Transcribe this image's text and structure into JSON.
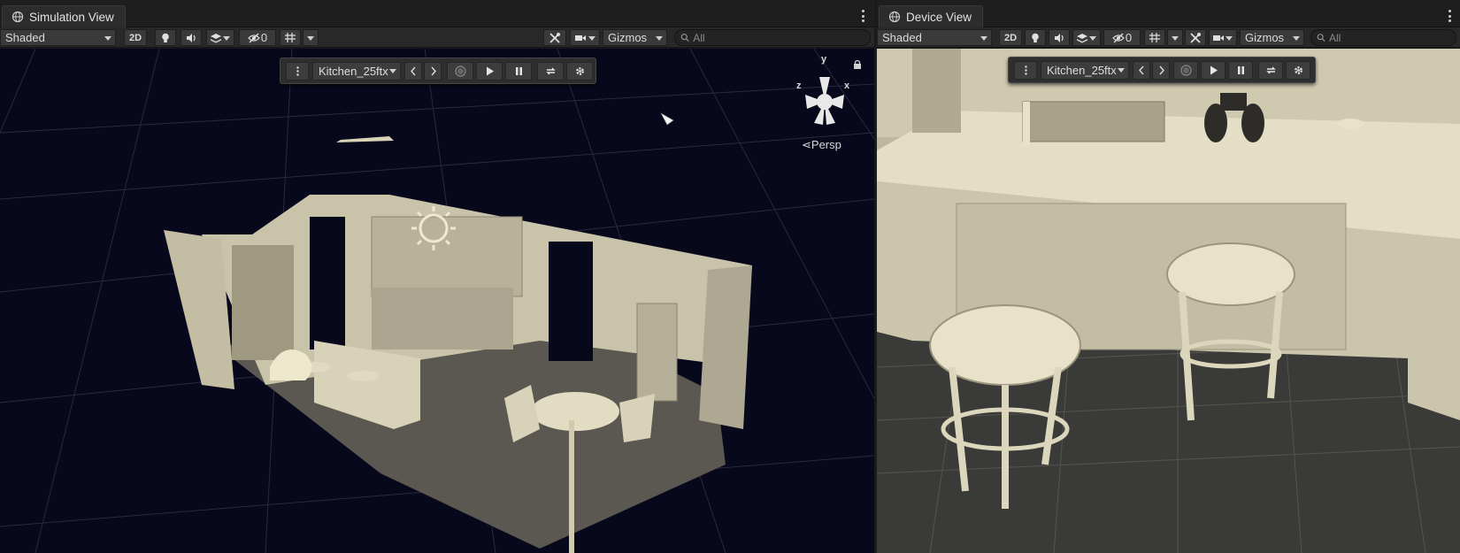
{
  "simulation": {
    "tab_title": "Simulation View",
    "draw_mode": "Shaded",
    "btn_2d": "2D",
    "hidden_count": "0",
    "gizmos_label": "Gizmos",
    "search_placeholder": "All",
    "scene_name": "Kitchen_25ftx",
    "projection": "Persp",
    "axes": {
      "y": "y",
      "x": "x",
      "z": "z"
    }
  },
  "device": {
    "tab_title": "Device View",
    "draw_mode": "Shaded",
    "btn_2d": "2D",
    "hidden_count": "0",
    "gizmos_label": "Gizmos",
    "search_placeholder": "All",
    "scene_name": "Kitchen_25ftx"
  },
  "icons": {
    "tab": "globe-icon",
    "toolbar": [
      "light-bulb-icon",
      "audio-icon",
      "effects-layers-icon",
      "hidden-eye-icon",
      "grid-icon",
      "tools-icon",
      "camera-icon",
      "search-icon",
      "lock-icon"
    ],
    "overlay": [
      "kebab-menu-icon",
      "prev-icon",
      "next-icon",
      "record-icon",
      "play-icon",
      "pause-icon",
      "restart-icon",
      "settings-icon"
    ]
  },
  "colors": {
    "viewport_bg": "#08081c",
    "panel_bg": "#1e1e1e",
    "toolbar_bg": "#282828",
    "scene_tint": "#c8c2a8"
  }
}
